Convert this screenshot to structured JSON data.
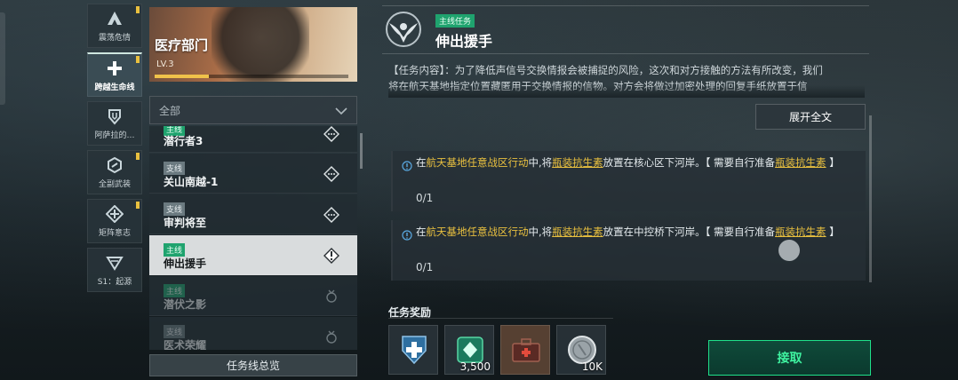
{
  "nav": {
    "items": [
      {
        "label": "震荡危情",
        "icon": "alert-a-icon",
        "badge": true,
        "active": false
      },
      {
        "label": "跨越生命线",
        "icon": "medical-cross-icon",
        "badge": true,
        "active": true
      },
      {
        "label": "阿萨拉的…",
        "icon": "shield-emblem-icon",
        "badge": false,
        "active": false
      },
      {
        "label": "全副武装",
        "icon": "hex-link-icon",
        "badge": true,
        "active": false
      },
      {
        "label": "矩阵意志",
        "icon": "diamond-cross-icon",
        "badge": true,
        "active": false
      },
      {
        "label": "S1：起源",
        "icon": "season-v-icon",
        "badge": false,
        "active": false
      }
    ]
  },
  "department": {
    "title": "医疗部门",
    "level": "LV.3",
    "progress": 0.28
  },
  "filter": {
    "value": "全部"
  },
  "quests": [
    {
      "tag": "主线",
      "tag_type": "main",
      "name": "潜行者3",
      "status_icon": "dots-diamond-icon"
    },
    {
      "tag": "支线",
      "tag_type": "side",
      "name": "关山南越-1",
      "status_icon": "dots-diamond-icon"
    },
    {
      "tag": "支线",
      "tag_type": "side",
      "name": "审判将至",
      "status_icon": "dots-diamond-icon"
    },
    {
      "tag": "主线",
      "tag_type": "main",
      "name": "伸出援手",
      "status_icon": "exclaim-diamond-icon"
    },
    {
      "tag": "主线",
      "tag_type": "main",
      "name": "潜伏之影",
      "status_icon": "locked-medal-icon"
    },
    {
      "tag": "支线",
      "tag_type": "side",
      "name": "医术荣耀",
      "status_icon": "locked-medal-icon"
    }
  ],
  "overview_button": "任务线总览",
  "detail": {
    "type_tag": "主线任务",
    "title": "伸出援手",
    "description_line1": "【任务内容】：为了降低声信号交换情报会被捕捉的风险，这次和对方接触的方法有所改变，我们",
    "description_line2": "将在航天基地指定位置藏匿用于交换情报的信物。对方会将做过加密处理的回复手纸放置于信",
    "expand_button": "展开全文",
    "objectives": [
      {
        "prefix": "在",
        "location": "航天基地任意战区行动",
        "middle": "中,将",
        "item": "瓶装抗生素",
        "suffix": "放置在核心区下河岸。【 需要自行准备",
        "item2": "瓶装抗生素",
        "end": "】",
        "progress": "0/1"
      },
      {
        "prefix": "在",
        "location": "航天基地任意战区行动",
        "middle": "中,将",
        "item": "瓶装抗生素",
        "suffix": "放置在中控桥下河岸。【 需要自行准备",
        "item2": "瓶装抗生素",
        "end": "】",
        "progress": "0/1"
      }
    ],
    "rewards_label": "任务奖励",
    "rewards": [
      {
        "icon": "medical-shield-icon",
        "count": ""
      },
      {
        "icon": "green-emblem-icon",
        "count": "3,500"
      },
      {
        "icon": "medkit-case-icon",
        "count": ""
      },
      {
        "icon": "silver-coin-icon",
        "count": "10K"
      }
    ],
    "accept_button": "接取"
  },
  "colors": {
    "accent_green": "#1fe08a",
    "tag_green": "#1fa36e",
    "highlight_yellow": "#e9c03f"
  }
}
